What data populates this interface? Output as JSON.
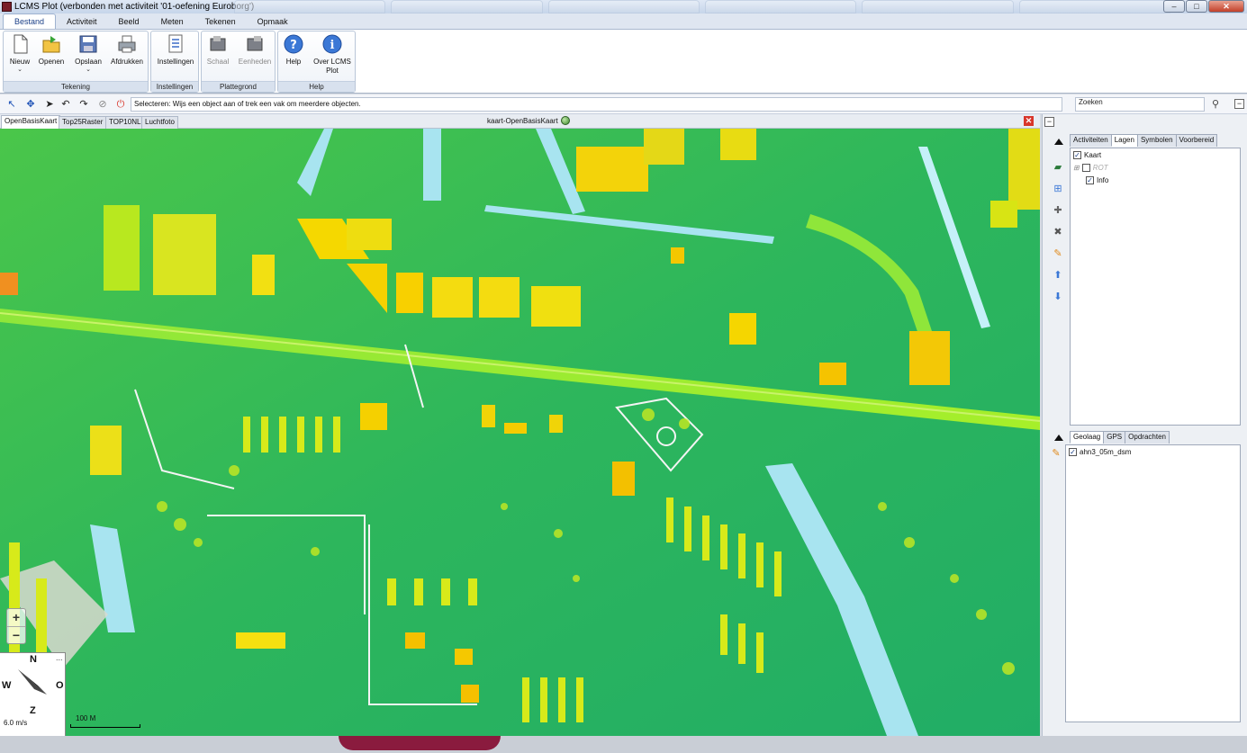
{
  "window": {
    "title": "LCMS Plot (verbonden met activiteit '01-oefening Euroborg')",
    "controls": [
      "–",
      "□",
      "✕"
    ]
  },
  "menu": [
    "Bestand",
    "Activiteit",
    "Beeld",
    "Meten",
    "Tekenen",
    "Opmaak"
  ],
  "ribbon": {
    "groups": [
      {
        "label": "Tekening",
        "buttons": [
          {
            "label": "Nieuw",
            "icon": "new-document-icon",
            "dropdown": true
          },
          {
            "label": "Openen",
            "icon": "open-folder-icon"
          },
          {
            "label": "Opslaan",
            "icon": "save-icon",
            "dropdown": true
          },
          {
            "label": "Afdrukken",
            "icon": "printer-icon"
          }
        ]
      },
      {
        "label": "Instellingen",
        "buttons": [
          {
            "label": "Instellingen",
            "icon": "settings-list-icon"
          }
        ]
      },
      {
        "label": "Plattegrond",
        "buttons": [
          {
            "label": "Schaal",
            "icon": "scale-icon",
            "disabled": true
          },
          {
            "label": "Eenheden",
            "icon": "units-icon",
            "disabled": true
          }
        ]
      },
      {
        "label": "Help",
        "buttons": [
          {
            "label": "Help",
            "icon": "help-icon"
          },
          {
            "label": "Over LCMS Plot",
            "icon": "info-icon"
          }
        ]
      }
    ]
  },
  "toolbar": {
    "status": "Selecteren: Wijs een object aan of trek een vak om meerdere objecten.",
    "search_value": "Zoeken"
  },
  "map": {
    "tabs": [
      "OpenBasisKaart",
      "Top25Raster",
      "TOP10NL",
      "Luchtfoto"
    ],
    "active_tab": "OpenBasisKaart",
    "caption": "kaart-OpenBasisKaart",
    "zoom_in": "+",
    "zoom_out": "−",
    "compass": {
      "n": "N",
      "w": "W",
      "o": "O",
      "z": "Z",
      "more": "...",
      "speed": "6.0 m/s"
    },
    "scale": "100 M",
    "colors": {
      "ground": "#33bb55",
      "building_low": "#9ae01c",
      "building_high": "#f5d100",
      "water": "#a8e4f0",
      "road": "#d9d9d0"
    }
  },
  "panel": {
    "tabs_top": [
      "Activiteiten",
      "Lagen",
      "Symbolen",
      "Voorbereid"
    ],
    "active_top": "Lagen",
    "layers": [
      {
        "label": "Kaart",
        "checked": true
      },
      {
        "label": "ROT",
        "checked": false,
        "dimmed": true
      },
      {
        "label": "Info",
        "checked": true
      }
    ],
    "tabs_bottom": [
      "Geolaag",
      "GPS",
      "Opdrachten"
    ],
    "active_bottom": "Geolaag",
    "geolayers": [
      {
        "label": "ahn3_05m_dsm",
        "checked": true
      }
    ]
  }
}
